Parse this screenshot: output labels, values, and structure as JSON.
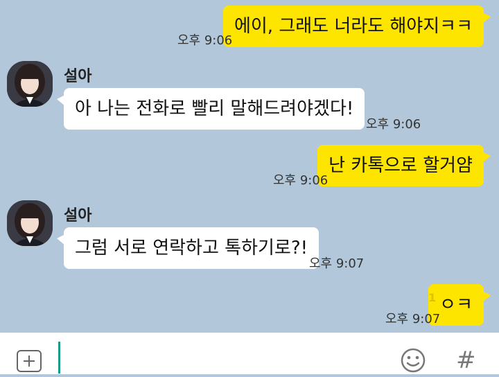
{
  "messages": [
    {
      "sender": "me",
      "text": "에이, 그래도 너라도 해야지ㅋㅋ",
      "time": "오후 9:06"
    },
    {
      "sender": "other",
      "name": "설아",
      "text": "아 나는 전화로 빨리 말해드려야겠다!",
      "time": "오후 9:06"
    },
    {
      "sender": "me",
      "text": "난 카톡으로 할거얌",
      "time": "오후 9:06"
    },
    {
      "sender": "other",
      "name": "설아",
      "text": "그럼 서로 연락하고 톡하기로?!",
      "time": "오후 9:07"
    },
    {
      "sender": "me",
      "text": "ㅇㅋ",
      "time": "오후 9:07",
      "unread": "1"
    }
  ],
  "colors": {
    "chat_background": "#b2c7d9",
    "my_bubble": "#fee500",
    "their_bubble": "#ffffff",
    "cursor": "#1a9c8c",
    "unread_count": "#e0c000"
  },
  "input_bar": {
    "attach_icon": "plus-square-icon",
    "emoji_icon": "smiley-icon",
    "hashtag_label": "#"
  }
}
